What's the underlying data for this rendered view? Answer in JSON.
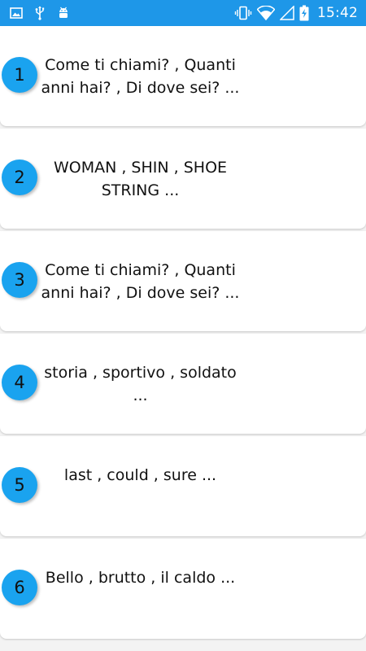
{
  "status_bar": {
    "time": "15:42",
    "bg_color": "#1e97e8",
    "left_icons": [
      "image-icon",
      "usb-icon",
      "android-icon"
    ],
    "right_icons": [
      "vibrate-icon",
      "wifi-icon",
      "signal-icon",
      "battery-charging-icon"
    ]
  },
  "lessons": [
    {
      "number": "1",
      "text": "Come ti chiami? , Quanti anni hai? , Di dove sei?  ..."
    },
    {
      "number": "2",
      "text": "WOMAN , SHIN , SHOE STRING  ..."
    },
    {
      "number": "3",
      "text": "Come ti chiami? , Quanti anni hai? , Di dove sei?  ..."
    },
    {
      "number": "4",
      "text": "storia , sportivo , soldato  ..."
    },
    {
      "number": "5",
      "text": "last , could , sure  ..."
    },
    {
      "number": "6",
      "text": "Bello , brutto , il caldo  ..."
    }
  ],
  "theme": {
    "badge_color": "#1aa3ef"
  }
}
